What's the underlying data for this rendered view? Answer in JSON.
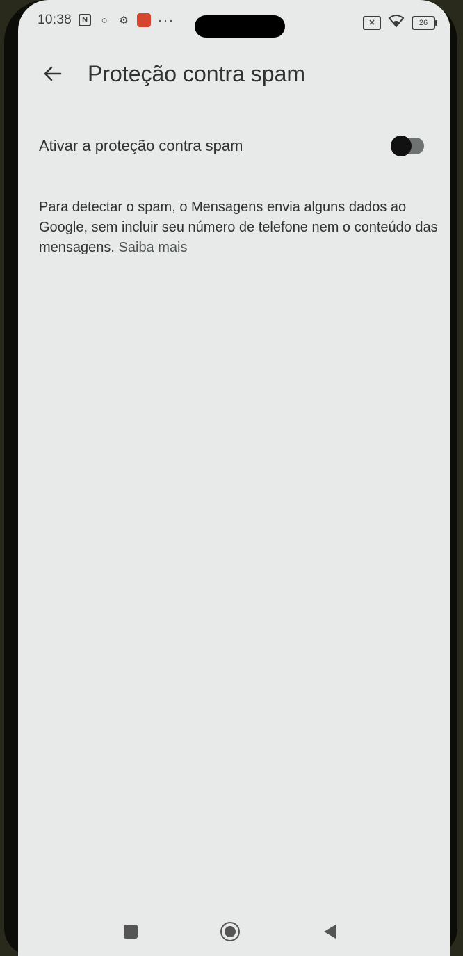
{
  "status_bar": {
    "time": "10:38",
    "icons_left": [
      "nfc-icon",
      "sim-status-icon",
      "settings-icon",
      "app-notification-icon"
    ],
    "overflow_dots": "···",
    "battery_level": "26"
  },
  "app_bar": {
    "title": "Proteção contra spam"
  },
  "spam_toggle": {
    "label": "Ativar a proteção contra spam",
    "enabled": false
  },
  "description": {
    "text": "Para detectar o spam, o Mensagens envia alguns dados ao Google, sem incluir seu número de telefone nem o conteúdo das mensagens.",
    "link_label": "Saiba mais"
  },
  "nav_bar": {
    "buttons": [
      "recents-button",
      "home-button",
      "back-button"
    ]
  }
}
